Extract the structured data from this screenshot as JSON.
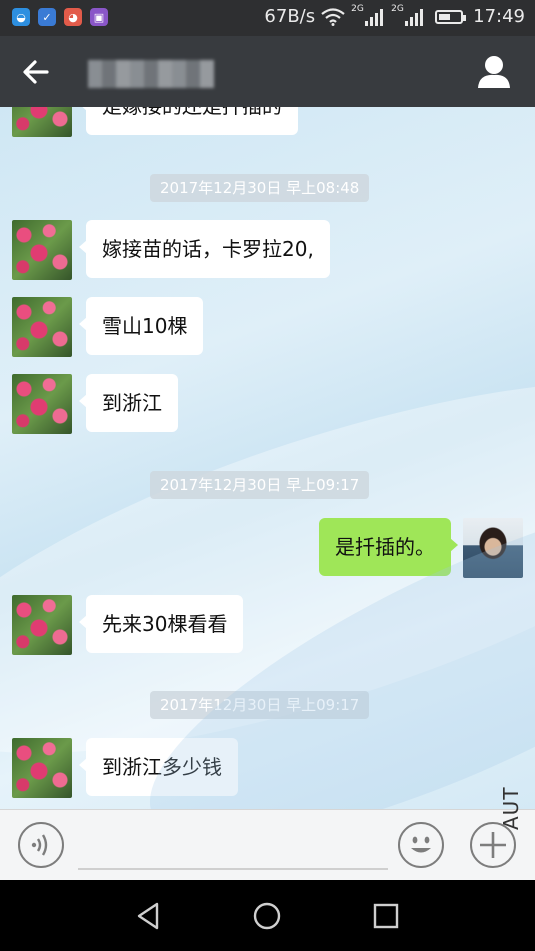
{
  "status_bar": {
    "net_speed": "67B/s",
    "sim1_tag": "2G",
    "sim2_tag": "2G",
    "battery_level": 0.55,
    "time": "17:49",
    "app_icons": [
      "qq-browser-icon",
      "shield-icon",
      "pet-icon",
      "gallery-icon"
    ]
  },
  "title_bar": {
    "back_icon": "arrow-left-icon",
    "contact_name": "",
    "profile_icon": "person-icon"
  },
  "chat": {
    "partial_message": "是嫁接的还是扦插的",
    "timestamps": [
      "2017年12月30日 早上08:48",
      "2017年12月30日 早上09:17",
      "2017年12月30日 早上09:17"
    ],
    "messages": [
      {
        "side": "left",
        "text": "嫁接苗的话，卡罗拉20,"
      },
      {
        "side": "left",
        "text": "雪山10棵"
      },
      {
        "side": "left",
        "text": "到浙江"
      },
      {
        "side": "right",
        "text": "是扦插的。"
      },
      {
        "side": "left",
        "text": "先来30棵看看"
      },
      {
        "side": "left",
        "text": "到浙江多少钱"
      }
    ]
  },
  "input_bar": {
    "text_value": "",
    "watermark": "AUT"
  },
  "nav_bar": {
    "icons": [
      "back-triangle-icon",
      "home-circle-icon",
      "recents-square-icon"
    ]
  },
  "colors": {
    "title_bar": "#383b3f",
    "sent_bubble": "#9fe658",
    "received_bubble": "#ffffff"
  }
}
